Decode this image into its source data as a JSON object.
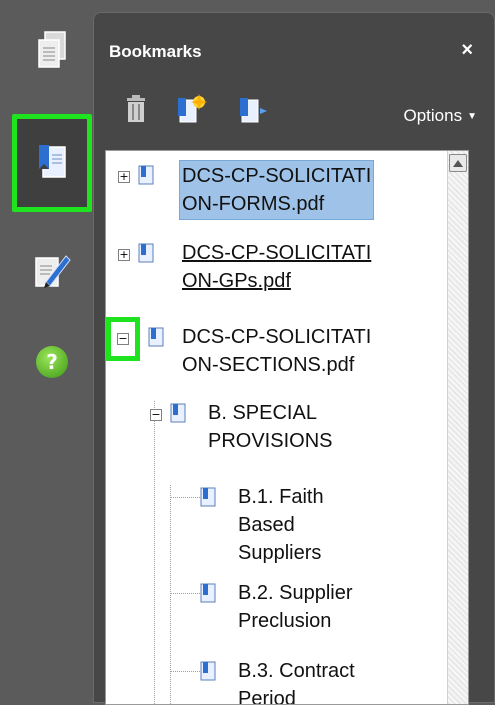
{
  "panel": {
    "title": "Bookmarks",
    "close_label": "×",
    "options_label": "Options",
    "options_caret": "▼"
  },
  "rail": {
    "items": [
      "pages-icon",
      "bookmarks-icon",
      "signature-icon",
      "help-icon"
    ],
    "help_label": "?"
  },
  "toolbar": {
    "icons": [
      "trash-icon",
      "new-bookmark-icon",
      "expand-bookmark-icon"
    ]
  },
  "tree": {
    "items": [
      {
        "line1": "DCS-CP-SOLICITATI",
        "line2": "ON-FORMS.pdf",
        "toggle": "+",
        "selected": true
      },
      {
        "line1": "DCS-CP-SOLICITATI",
        "line2": "ON-GPs.pdf",
        "toggle": "+",
        "underline": true
      },
      {
        "line1": "DCS-CP-SOLICITATI",
        "line2": "ON-SECTIONS.pdf",
        "toggle": "−"
      },
      {
        "line1": "B. SPECIAL",
        "line2": "PROVISIONS",
        "toggle": "−"
      },
      {
        "line1": "B.1. Faith",
        "line2": "Based",
        "line3": "Suppliers"
      },
      {
        "line1": "B.2. Supplier",
        "line2": "Preclusion"
      },
      {
        "line1": "B.3. Contract",
        "line2": "Period"
      }
    ]
  },
  "colors": {
    "highlight": "#1fe31f",
    "selection": "#9fc3e8",
    "panel_bg": "#474747",
    "background": "#5b5b5b"
  }
}
